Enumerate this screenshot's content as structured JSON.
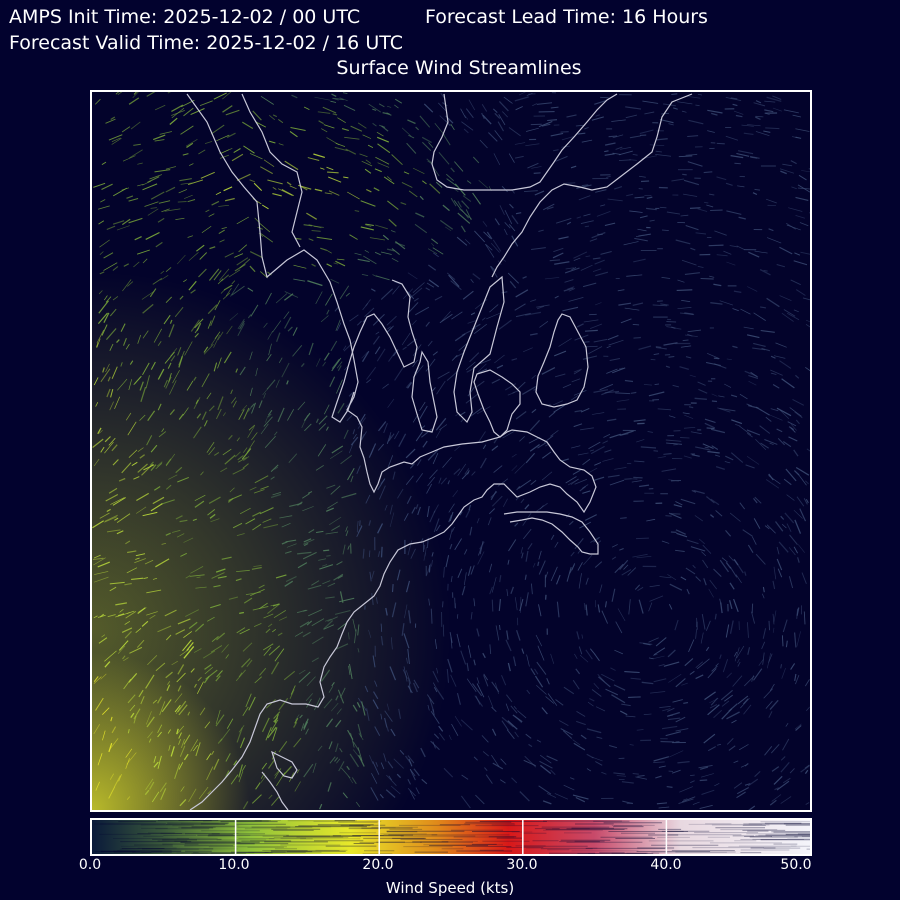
{
  "header": {
    "init_time": "AMPS Init Time: 2025-12-02 / 00 UTC",
    "lead_time": "Forecast Lead Time: 16 Hours",
    "valid_time": "Forecast Valid Time: 2025-12-02 / 16 UTC"
  },
  "map": {
    "title": "Surface Wind Streamlines",
    "background_color": "#02022e",
    "coastline_color": "#c8c8d8"
  },
  "colorbar": {
    "label": "Wind Speed (kts)",
    "ticks": [
      "0.0",
      "10.0",
      "20.0",
      "30.0",
      "40.0",
      "50.0"
    ],
    "range": [
      0,
      50
    ],
    "colors": [
      "#0a1a3a",
      "#4b6b2a",
      "#9acd32",
      "#e8e82a",
      "#e08a1a",
      "#d81818",
      "#e8c8d0",
      "#ffffff"
    ]
  }
}
